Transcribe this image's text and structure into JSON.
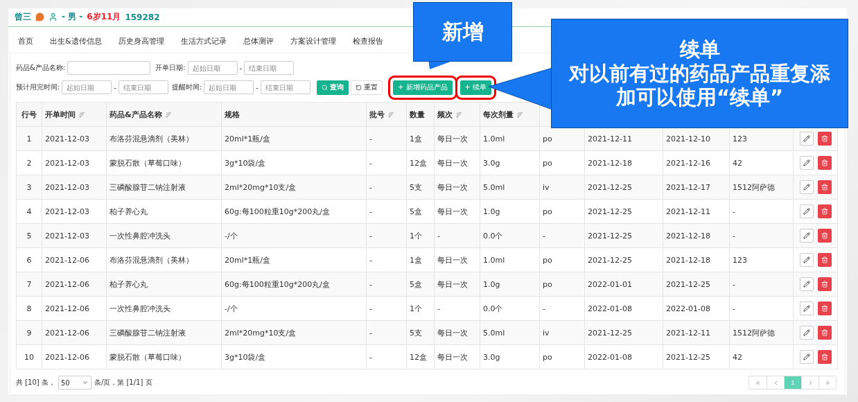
{
  "patient": {
    "name": "曾三",
    "sex": "- 男 -",
    "age": "6岁11月",
    "phone": "159282"
  },
  "tabs": [
    {
      "label": "首页",
      "selected": false
    },
    {
      "label": "出生&遗传信息",
      "selected": false
    },
    {
      "label": "历史身高管理",
      "selected": false
    },
    {
      "label": "生活方式记录",
      "selected": false
    },
    {
      "label": "总体测评",
      "selected": false
    },
    {
      "label": "方案设计管理",
      "selected": false
    },
    {
      "label": "检查报告",
      "selected": false
    }
  ],
  "filters": {
    "name_label": "药品&产品名称:",
    "order_date_label": "开单日期:",
    "order_start_placeholder": "起始日期",
    "order_end_placeholder": "结束日期",
    "finish_label": "预计用完时间:",
    "finish_start_placeholder": "起始日期",
    "finish_end_placeholder": "结束日期",
    "remind_label": "提醒时间:",
    "remind_start_placeholder": "起始日期",
    "remind_end_placeholder": "结束日期",
    "dash": "-"
  },
  "buttons": [
    {
      "kind": "search",
      "label": "查询"
    },
    {
      "kind": "reset",
      "label": "重置"
    },
    {
      "kind": "add",
      "label": "+ 新增药品产品",
      "highlighted": true
    },
    {
      "kind": "add",
      "label": "+ 续单",
      "highlighted": true
    }
  ],
  "table": {
    "columns": [
      {
        "label": "行号",
        "sortable": false
      },
      {
        "label": "开单时间",
        "sortable": true
      },
      {
        "label": "药品&产品名称",
        "sortable": true
      },
      {
        "label": "规格",
        "sortable": false
      },
      {
        "label": "批号",
        "sortable": true
      },
      {
        "label": "数量",
        "sortable": false
      },
      {
        "label": "频次",
        "sortable": true
      },
      {
        "label": "每次剂量",
        "sortable": true
      }
    ],
    "rows": [
      [
        "1",
        "2021-12-03",
        "布洛芬混悬滴剂（美林）",
        "20ml*1瓶/盒",
        "-",
        "1盒",
        "每日一次",
        "1.0ml",
        "po",
        "2021-12-11",
        "2021-12-10",
        "123"
      ],
      [
        "2",
        "2021-12-03",
        "蒙脱石散（草莓口味）",
        "3g*10袋/盒",
        "-",
        "12盒",
        "每日一次",
        "3.0g",
        "po",
        "2021-12-18",
        "2021-12-16",
        "42"
      ],
      [
        "3",
        "2021-12-03",
        "三磷酸腺苷二钠注射液",
        "2ml*20mg*10支/盒",
        "-",
        "5支",
        "每日一次",
        "5.0ml",
        "iv",
        "2021-12-25",
        "2021-12-17",
        "1512阿萨德"
      ],
      [
        "4",
        "2021-12-03",
        "柏子养心丸",
        "60g:每100粒重10g*200丸/盒",
        "-",
        "5盒",
        "每日一次",
        "1.0g",
        "po",
        "2021-12-25",
        "2021-12-11",
        "-"
      ],
      [
        "5",
        "2021-12-03",
        "一次性鼻腔冲洗头",
        "-/个",
        "-",
        "1个",
        "-",
        "0.0个",
        "-",
        "2021-12-25",
        "2021-12-18",
        "-"
      ],
      [
        "6",
        "2021-12-06",
        "布洛芬混悬滴剂（美林）",
        "20ml*1瓶/盒",
        "-",
        "1盒",
        "每日一次",
        "1.0ml",
        "po",
        "2021-12-25",
        "2021-12-18",
        "123"
      ],
      [
        "7",
        "2021-12-06",
        "柏子养心丸",
        "60g:每100粒重10g*200丸/盒",
        "-",
        "5盒",
        "每日一次",
        "1.0g",
        "po",
        "2022-01-01",
        "2021-12-25",
        "-"
      ],
      [
        "8",
        "2021-12-06",
        "一次性鼻腔冲洗头",
        "-/个",
        "-",
        "1个",
        "-",
        "0.0个",
        "-",
        "2022-01-08",
        "2022-01-08",
        "-"
      ],
      [
        "9",
        "2021-12-06",
        "三磷酸腺苷二钠注射液",
        "2ml*20mg*10支/盒",
        "-",
        "5支",
        "每日一次",
        "5.0ml",
        "iv",
        "2021-12-25",
        "2021-12-11",
        "1512阿萨德"
      ],
      [
        "10",
        "2021-12-06",
        "蒙脱石散（草莓口味）",
        "3g*10袋/盒",
        "-",
        "12盒",
        "每日一次",
        "3.0g",
        "po",
        "2022-01-08",
        "2021-12-25",
        "42"
      ]
    ]
  },
  "pagination": {
    "total": "共 [10] 条，",
    "page_size": "50",
    "summary": "条/页，第 [1/1] 页",
    "pages": [
      {
        "label": "1",
        "selected": true
      }
    ]
  },
  "callouts": [
    {
      "kind": "small",
      "title": "新增"
    },
    {
      "kind": "large",
      "title": "续单",
      "text": "对以前有过的药品产品重复添加可以使用“续单”"
    }
  ]
}
